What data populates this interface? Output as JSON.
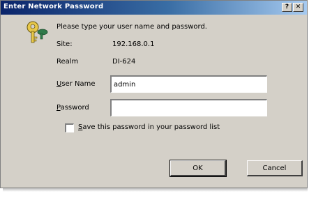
{
  "window": {
    "title": "Enter Network Password",
    "help_label": "?",
    "close_label": "✕"
  },
  "prompt": "Please type your user name and password.",
  "site": {
    "label": "Site:",
    "value": "192.168.0.1"
  },
  "realm": {
    "label": "Realm",
    "value": "DI-624"
  },
  "username": {
    "label_first": "U",
    "label_rest": "ser Name",
    "value": "admin"
  },
  "password": {
    "label_first": "P",
    "label_rest": "assword",
    "value": ""
  },
  "save_password": {
    "label_first": "S",
    "label_rest": "ave this password in your password list",
    "checked": false
  },
  "buttons": {
    "ok": "OK",
    "cancel": "Cancel"
  },
  "colors": {
    "titlebar_start": "#0a246a",
    "titlebar_end": "#a6caf0",
    "dialog_face": "#d4d0c8"
  },
  "icons": {
    "key": "key-icon"
  }
}
